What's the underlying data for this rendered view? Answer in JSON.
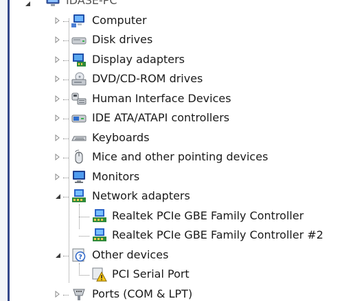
{
  "root": {
    "label": "IDASE-PC"
  },
  "devices": [
    {
      "label": "Computer",
      "icon": "computer-icon",
      "expanded": false
    },
    {
      "label": "Disk drives",
      "icon": "disk-drive-icon",
      "expanded": false
    },
    {
      "label": "Display adapters",
      "icon": "display-adapter-icon",
      "expanded": false
    },
    {
      "label": "DVD/CD-ROM drives",
      "icon": "dvd-drive-icon",
      "expanded": false
    },
    {
      "label": "Human Interface Devices",
      "icon": "hid-icon",
      "expanded": false
    },
    {
      "label": "IDE ATA/ATAPI controllers",
      "icon": "ide-controller-icon",
      "expanded": false
    },
    {
      "label": "Keyboards",
      "icon": "keyboard-icon",
      "expanded": false
    },
    {
      "label": "Mice and other pointing devices",
      "icon": "mouse-icon",
      "expanded": false
    },
    {
      "label": "Monitors",
      "icon": "monitor-icon",
      "expanded": false
    },
    {
      "label": "Network adapters",
      "icon": "network-adapter-icon",
      "expanded": true,
      "children": [
        {
          "label": "Realtek PCIe GBE Family Controller",
          "icon": "network-adapter-icon"
        },
        {
          "label": "Realtek PCIe GBE Family Controller #2",
          "icon": "network-adapter-icon"
        }
      ]
    },
    {
      "label": "Other devices",
      "icon": "unknown-device-icon",
      "expanded": true,
      "children": [
        {
          "label": "PCI Serial Port",
          "icon": "warning-device-icon"
        }
      ]
    },
    {
      "label": "Ports (COM & LPT)",
      "icon": "port-icon",
      "expanded": false
    }
  ]
}
